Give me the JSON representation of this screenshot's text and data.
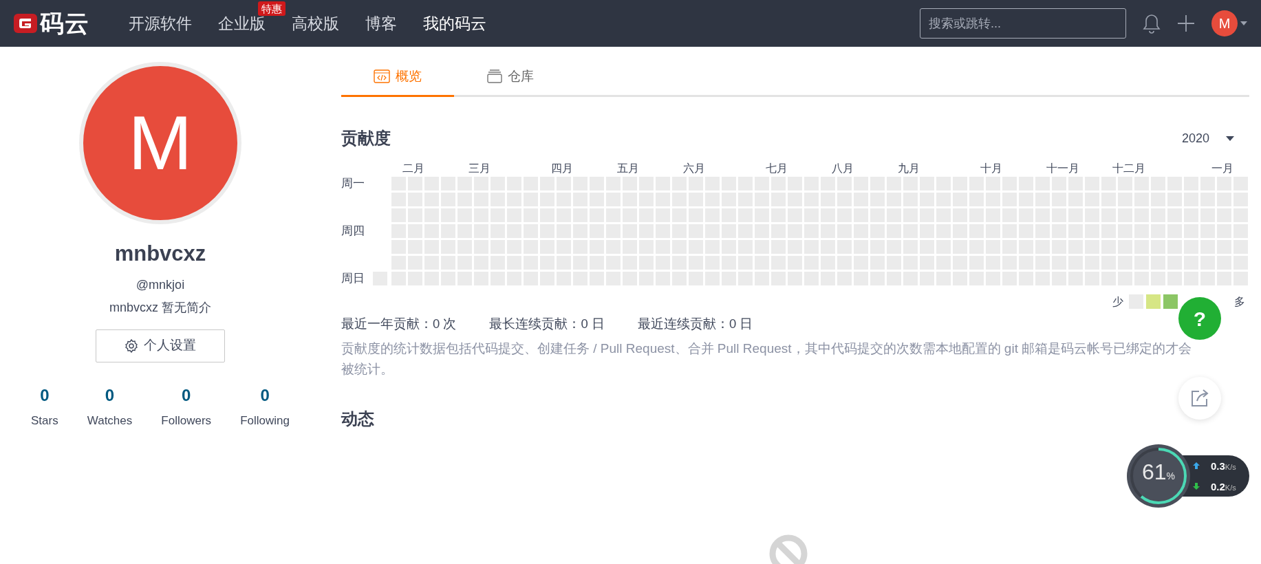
{
  "navbar": {
    "logo_text": "码云",
    "links": [
      {
        "label": "开源软件",
        "selected": false
      },
      {
        "label": "企业版",
        "selected": false,
        "badge": "特惠"
      },
      {
        "label": "高校版",
        "selected": false
      },
      {
        "label": "博客",
        "selected": false
      },
      {
        "label": "我的码云",
        "selected": true
      }
    ],
    "search": {
      "placeholder": "搜索或跳转..."
    },
    "user_avatar": "M"
  },
  "profile": {
    "avatar_letter": "M",
    "name": "mnbvcxz",
    "username": "@mnkjoi",
    "bio": "mnbvcxz 暂无简介",
    "settings_button": "个人设置",
    "stats": [
      {
        "value": "0",
        "label": "Stars"
      },
      {
        "value": "0",
        "label": "Watches"
      },
      {
        "value": "0",
        "label": "Followers"
      },
      {
        "value": "0",
        "label": "Following"
      }
    ]
  },
  "tabs": [
    {
      "label": "概览",
      "kind": "overview",
      "selected": true
    },
    {
      "label": "仓库",
      "kind": "repos",
      "selected": false
    }
  ],
  "contribution": {
    "title": "贡献度",
    "year": "2020",
    "months": [
      "二月",
      "三月",
      "四月",
      "五月",
      "六月",
      "七月",
      "八月",
      "九月",
      "十月",
      "十一月",
      "十二月",
      "一月"
    ],
    "weekdays": [
      "周一",
      "周四",
      "周日"
    ],
    "legend_low": "少",
    "legend_high": "多",
    "legend_levels": [
      {
        "color": "#ebebeb"
      },
      {
        "color": "#d6e685"
      },
      {
        "color": "#8cc665"
      }
    ],
    "summary": [
      "最近一年贡献：0 次",
      "最长连续贡献：0 日",
      "最近连续贡献：0 日"
    ],
    "note": "贡献度的统计数据包括代码提交、创建任务 / Pull Request、合并 Pull Request，其中代码提交的次数需本地配置的 git 邮箱是码云帐号已绑定的才会被统计。"
  },
  "activity": {
    "title": "动态"
  },
  "help_button": {
    "label": "?"
  },
  "network_monitor": {
    "percent": "61",
    "percent_unit": "%",
    "level": 0.61,
    "upload": {
      "value": "0.3",
      "unit": "K/s"
    },
    "download": {
      "value": "0.2",
      "unit": "K/s"
    }
  }
}
